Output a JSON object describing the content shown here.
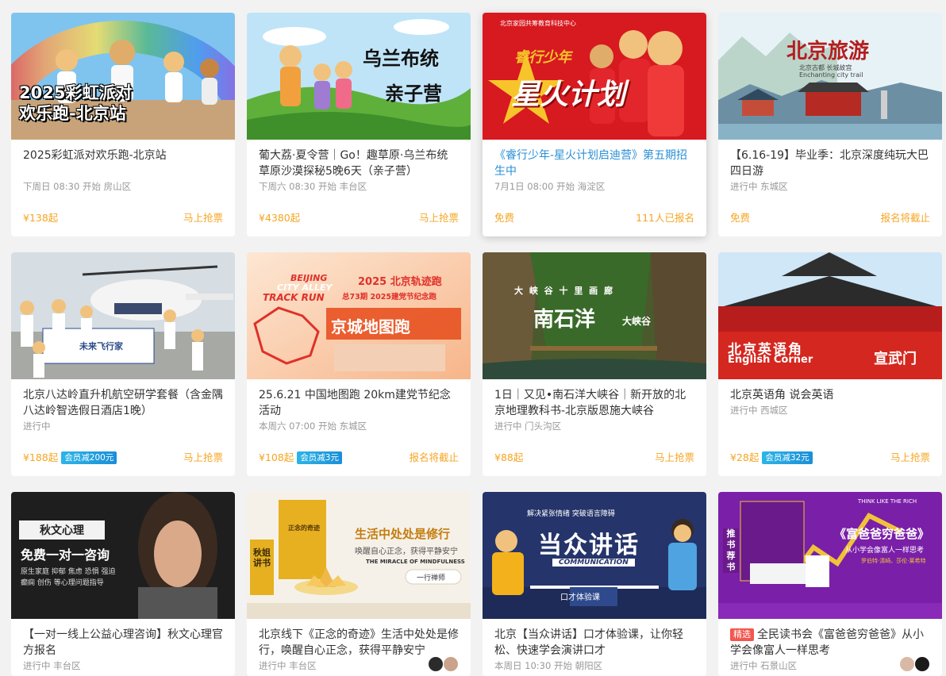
{
  "cards": [
    {
      "title": "2025彩虹派对欢乐跑-北京站",
      "meta": "下周日 08:30 开始 房山区",
      "price": "¥138起",
      "action": "马上抢票",
      "image": {
        "text": "2025彩虹派对\n欢乐跑-北京站",
        "line1": "2025彩虹派对",
        "line2": "欢乐跑-北京站"
      }
    },
    {
      "title": "葡大荔·夏令营｜Go！趣草原·乌兰布统草原沙漠探秘5晚6天（亲子营）",
      "meta": "下周六 08:30 开始 丰台区",
      "price": "¥4380起",
      "action": "马上抢票",
      "image": {
        "line1": "乌兰布统",
        "line2": "亲子营"
      }
    },
    {
      "title": "《睿行少年-星火计划启迪营》第五期招生中",
      "meta": "7月1日 08:00 开始 海淀区",
      "price": "免费",
      "action": "111人已报名",
      "image": {
        "org": "北京家园共筹教育科技中心",
        "line1": "睿行少年",
        "line2": "星火计划"
      }
    },
    {
      "title": "【6.16-19】毕业季：北京深度纯玩大巴四日游",
      "meta": "进行中 东城区",
      "price": "免费",
      "action": "报名将截止",
      "image": {
        "line1": "北京旅游",
        "line2": "北京古都 长城故宫",
        "line3": "Enchanting city trail"
      }
    },
    {
      "title": "北京八达岭直升机航空研学套餐（含金隅八达岭智选假日酒店1晚）",
      "meta": "进行中",
      "price": "¥188起",
      "badge": "会员减200元",
      "action": "马上抢票",
      "image": {
        "line1": "未来飞行家"
      }
    },
    {
      "title": "25.6.21 中国地图跑 20km建党节纪念活动",
      "meta": "本周六 07:00 开始 东城区",
      "price": "¥108起",
      "badge": "会员减3元",
      "action": "报名将截止",
      "image": {
        "en1": "BEIJING",
        "en2": "CITY ALLEY",
        "en3": "TRACK RUN",
        "cn1": "2025 北京轨迹跑",
        "cn2": "总73期  2025建党节纪念跑",
        "cn3": "京城地图跑"
      }
    },
    {
      "title": "1日｜又见•南石洋大峡谷｜新开放的北京地理教科书-北京版恩施大峡谷",
      "meta": "进行中 门头沟区",
      "price": "¥88起",
      "action": "马上抢票",
      "image": {
        "line1": "大 峡 谷 十 里 画 廊",
        "line2": "南石洋",
        "line3": "大峡谷"
      }
    },
    {
      "title": "北京英语角 说会英语",
      "meta": "进行中 西城区",
      "price": "¥28起",
      "badge": "会员减32元",
      "action": "马上抢票",
      "image": {
        "line1": "北京英语角",
        "line2": "English Corner",
        "line3": "宣武门"
      }
    },
    {
      "title": "【一对一线上公益心理咨询】秋文心理官方报名",
      "meta": "进行中 丰台区",
      "image": {
        "line1": "秋文心理",
        "line2": "免费一对一咨询",
        "line3": "原生家庭 抑郁 焦虑 恐惧 强迫 癫痫 创伤 等心理问题指导"
      }
    },
    {
      "title": "北京线下《正念的奇迹》生活中处处是修行，唤醒自心正念，获得平静安宁",
      "meta": "进行中 丰台区",
      "image": {
        "line1": "生活中处处是修行",
        "line2": "唤醒自心正念，获得平静安宁",
        "line3": "THE MIRACLE OF MINDFULNESS",
        "line4": "一行禅师",
        "line5": "秋姐讲书",
        "book": "正念的奇迹"
      }
    },
    {
      "title": "北京【当众讲话】口才体验课，让你轻松、快速学会演讲口才",
      "meta": "本周日 10:30 开始 朝阳区",
      "image": {
        "line1": "解决紧张情绪  突破语言障碍",
        "line2": "当众讲话",
        "line3": "COMMUNICATION",
        "line4": "口才体验课"
      }
    },
    {
      "title": "全民读书会《富爸爸穷爸爸》从小学会像富人一样思考",
      "tag": "精选",
      "meta": "进行中 石景山区",
      "image": {
        "line1": "《富爸爸穷爸爸》",
        "line2": "从小学会像富人一样思考",
        "line3": "罗伯特·清崎、莎伦·莱希特",
        "line4": "推书荐书",
        "line5": "THINK LIKE THE RICH"
      }
    }
  ]
}
